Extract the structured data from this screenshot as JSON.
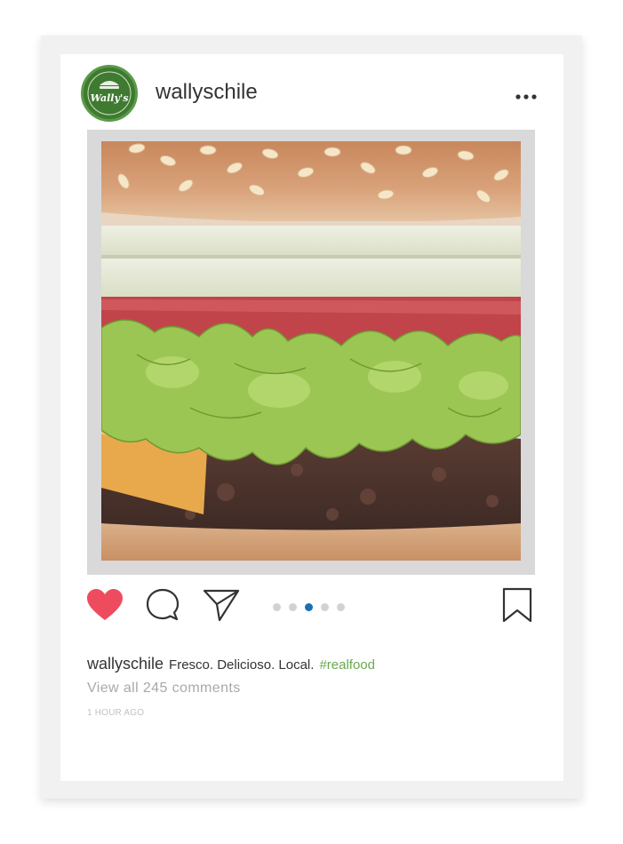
{
  "post": {
    "username": "wallyschile",
    "avatar_brand": "Wally's",
    "menu_icon": "more-horizontal-icon",
    "carousel": {
      "count": 5,
      "active_index": 2
    },
    "actions": {
      "like_icon": "heart-icon",
      "comment_icon": "comment-icon",
      "share_icon": "paper-plane-icon",
      "save_icon": "bookmark-icon"
    },
    "caption": {
      "username": "wallyschile",
      "text": "Fresco. Delicioso. Local.",
      "hashtag": "#realfood"
    },
    "comments_link": "View all 245 comments",
    "timestamp": "1 HOUR AGO"
  },
  "colors": {
    "like": "#ef4b5f",
    "active_dot": "#1b6fb5",
    "hashtag": "#6aa84f",
    "avatar": "#3f7a31"
  }
}
